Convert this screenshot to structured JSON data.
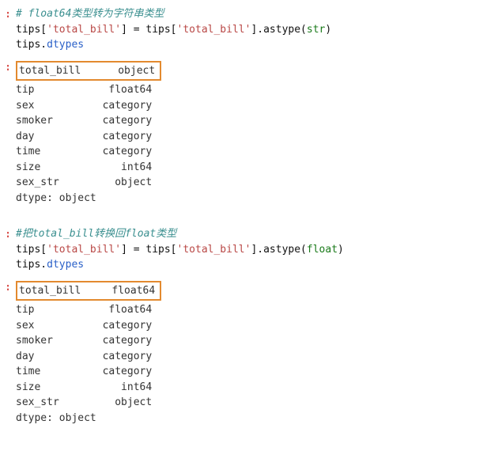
{
  "cell1": {
    "comment": "# float64类型转为字符串类型",
    "code_line1_a": "tips[",
    "code_line1_str1": "'total_bill'",
    "code_line1_b": "] = tips[",
    "code_line1_str2": "'total_bill'",
    "code_line1_c": "].astype(",
    "code_line1_builtin": "str",
    "code_line1_d": ")",
    "code_line2_a": "tips.",
    "code_line2_attr": "dtypes"
  },
  "output1": {
    "highlight_row": "total_bill      object",
    "rows": "tip            float64\nsex           category\nsmoker        category\nday           category\ntime          category\nsize             int64\nsex_str         object",
    "footer": "dtype: object"
  },
  "cell2": {
    "comment": "#把total_bill转换回float类型",
    "code_line1_a": "tips[",
    "code_line1_str1": "'total_bill'",
    "code_line1_b": "] = tips[",
    "code_line1_str2": "'total_bill'",
    "code_line1_c": "].astype(",
    "code_line1_builtin": "float",
    "code_line1_d": ")",
    "code_line2_a": "tips.",
    "code_line2_attr": "dtypes"
  },
  "output2": {
    "highlight_row": "total_bill     float64",
    "rows": "tip            float64\nsex           category\nsmoker        category\nday           category\ntime          category\nsize             int64\nsex_str         object",
    "footer": "dtype: object"
  }
}
